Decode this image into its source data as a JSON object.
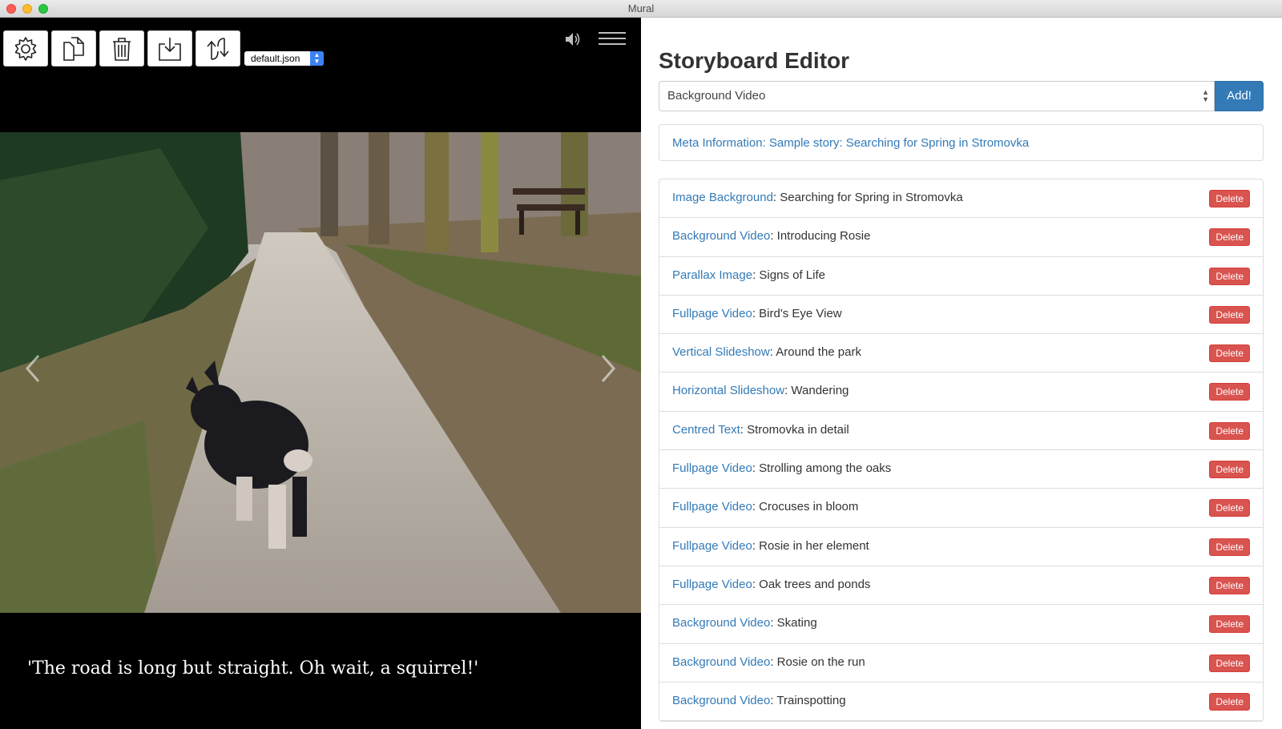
{
  "window": {
    "title": "Mural"
  },
  "toolbar": {
    "buttons": [
      {
        "icon": "gear-icon"
      },
      {
        "icon": "copy-icon"
      },
      {
        "icon": "trash-icon"
      },
      {
        "icon": "download-icon"
      },
      {
        "icon": "refresh-icon"
      }
    ],
    "file_select": {
      "value": "default.json"
    }
  },
  "preview": {
    "caption": "'The road is long but straight. Oh wait, a squirrel!'"
  },
  "editor": {
    "title": "Storyboard Editor",
    "type_select": {
      "value": "Background Video"
    },
    "add_label": "Add!",
    "meta": {
      "label": "Meta Information",
      "sep": ": ",
      "value": "Sample story: Searching for Spring in Stromovka"
    },
    "delete_label": "Delete",
    "items": [
      {
        "type": "Image Background",
        "title": "Searching for Spring in Stromovka"
      },
      {
        "type": "Background Video",
        "title": "Introducing Rosie"
      },
      {
        "type": "Parallax Image",
        "title": "Signs of Life"
      },
      {
        "type": "Fullpage Video",
        "title": "Bird's Eye View"
      },
      {
        "type": "Vertical Slideshow",
        "title": "Around the park"
      },
      {
        "type": "Horizontal Slideshow",
        "title": "Wandering"
      },
      {
        "type": "Centred Text",
        "title": "Stromovka in detail"
      },
      {
        "type": "Fullpage Video",
        "title": "Strolling among the oaks"
      },
      {
        "type": "Fullpage Video",
        "title": "Crocuses in bloom"
      },
      {
        "type": "Fullpage Video",
        "title": "Rosie in her element"
      },
      {
        "type": "Fullpage Video",
        "title": "Oak trees and ponds"
      },
      {
        "type": "Background Video",
        "title": "Skating"
      },
      {
        "type": "Background Video",
        "title": "Rosie on the run"
      },
      {
        "type": "Background Video",
        "title": "Trainspotting"
      }
    ]
  },
  "colors": {
    "link": "#337ab7",
    "danger": "#d9534f",
    "primary": "#337ab7"
  }
}
